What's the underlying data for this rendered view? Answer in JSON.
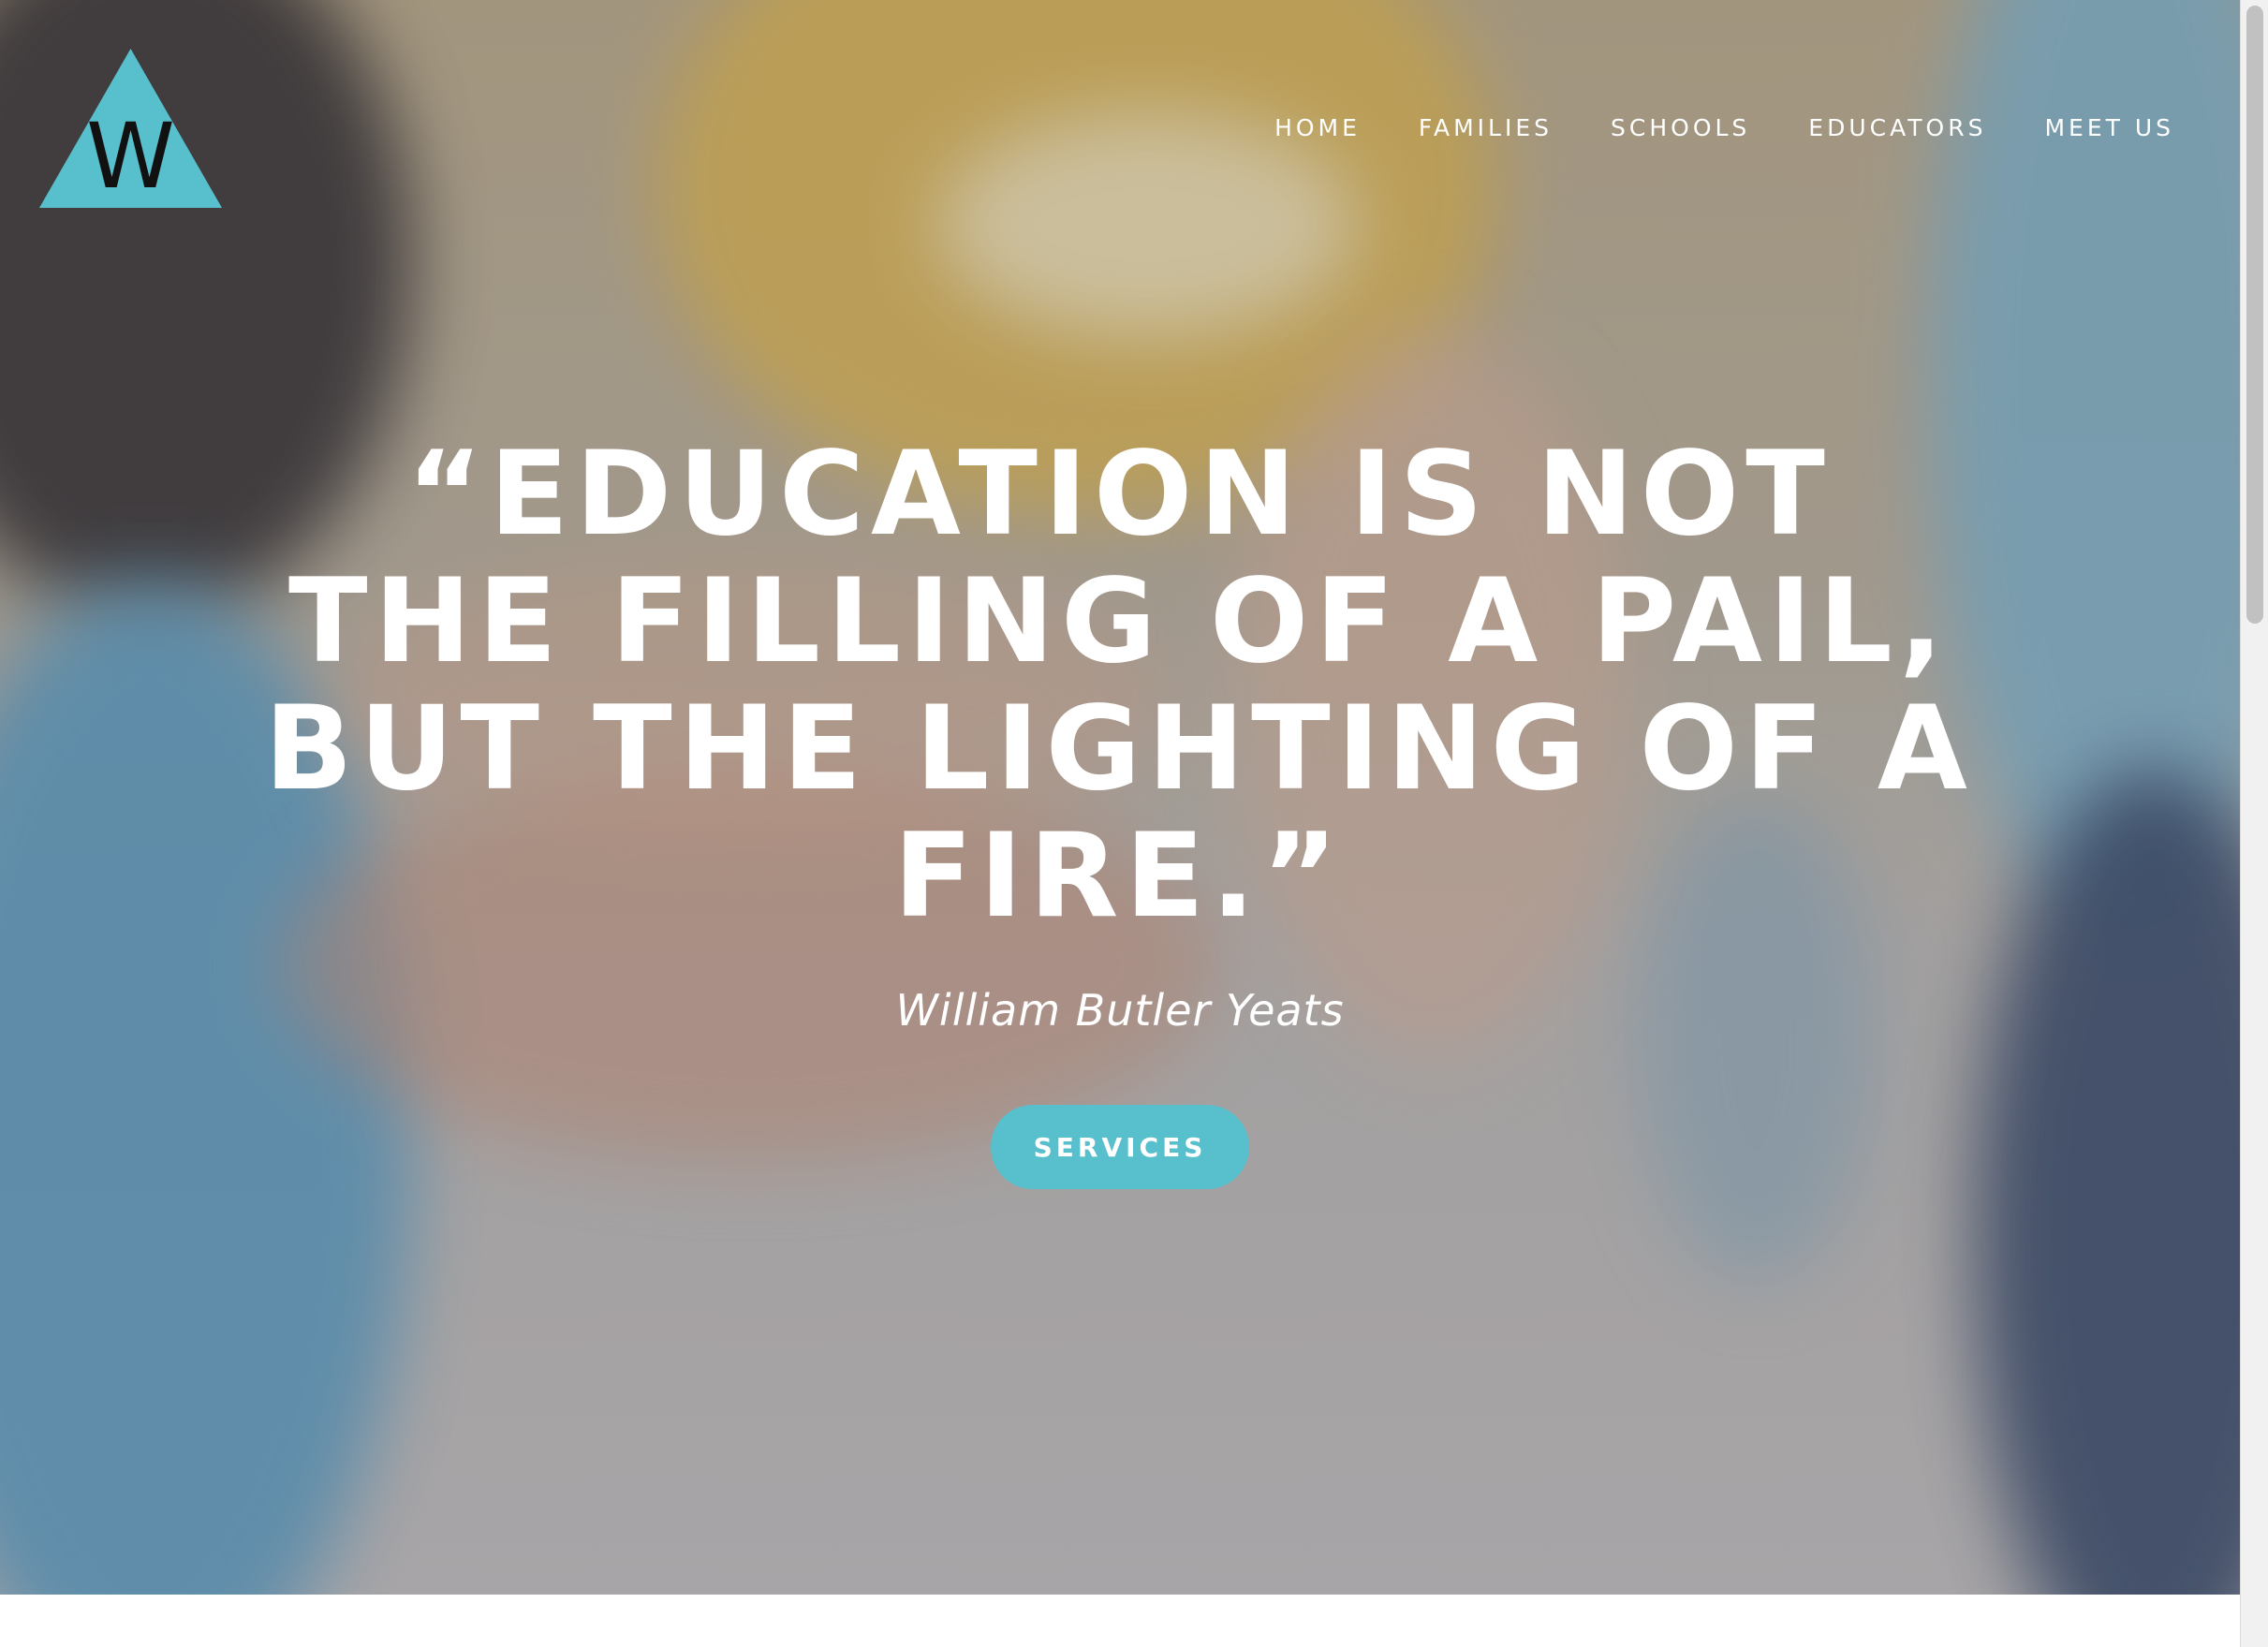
{
  "logo": {
    "letter": "W",
    "color": "#58c0cc",
    "icon": "triangle-logo-icon"
  },
  "nav": {
    "items": [
      {
        "label": "HOME"
      },
      {
        "label": "FAMILIES"
      },
      {
        "label": "SCHOOLS"
      },
      {
        "label": "EDUCATORS"
      },
      {
        "label": "MEET US"
      }
    ]
  },
  "hero": {
    "quote_lines": [
      "“EDUCATION IS NOT",
      "THE FILLING OF A PAIL,",
      "BUT THE LIGHTING OF A",
      "FIRE.”"
    ],
    "author": "William Butler Yeats",
    "cta_label": "SERVICES",
    "accent_color": "#58c0cc"
  }
}
